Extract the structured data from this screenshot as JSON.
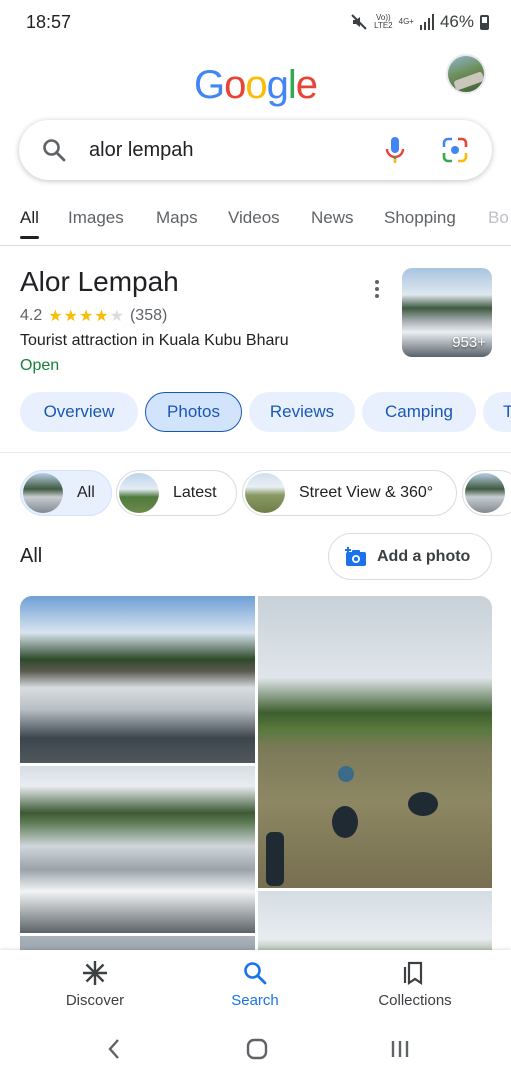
{
  "status_bar": {
    "time": "18:57",
    "volte": "Vo))",
    "lte": "LTE2",
    "net": "4G+",
    "battery": "46%"
  },
  "header": {
    "logo": [
      "G",
      "o",
      "o",
      "g",
      "l",
      "e"
    ],
    "logo_colors": [
      "#4285F4",
      "#EA4335",
      "#FBBC05",
      "#4285F4",
      "#34A853",
      "#EA4335"
    ]
  },
  "search": {
    "query": "alor lempah"
  },
  "tabs": [
    "All",
    "Images",
    "Maps",
    "Videos",
    "News",
    "Shopping",
    "Bo"
  ],
  "place": {
    "title": "Alor Lempah",
    "rating": "4.2",
    "rating_value": 4.2,
    "reviews": "(358)",
    "type": "Tourist attraction in Kuala Kubu Bharu",
    "status": "Open",
    "photo_count": "953+"
  },
  "chips": [
    "Overview",
    "Photos",
    "Reviews",
    "Camping",
    "T"
  ],
  "photo_filters": [
    "All",
    "Latest",
    "Street View & 360°"
  ],
  "photos_section": {
    "title": "All",
    "add_photo": "Add a photo"
  },
  "bottom_nav": {
    "discover": "Discover",
    "search": "Search",
    "collections": "Collections"
  },
  "colors": {
    "accent": "#1a73e8",
    "chip_text": "#1a57b5",
    "open_green": "#188038",
    "star": "#fbbc04"
  }
}
